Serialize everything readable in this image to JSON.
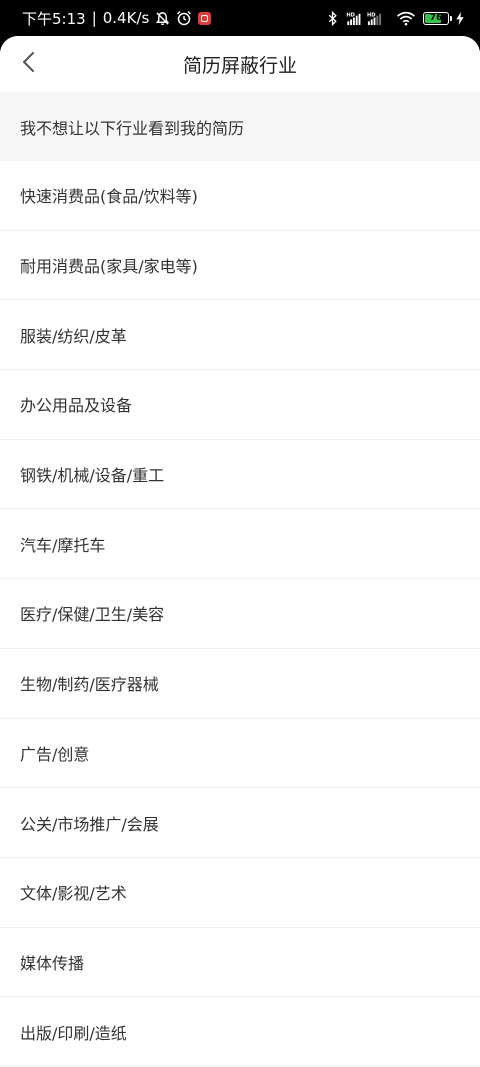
{
  "status_bar": {
    "time": "下午5:13",
    "separator": "|",
    "net_speed": "0.4K/s",
    "battery_level": "76",
    "battery_fill_fraction": 0.76,
    "icons": [
      "mute-icon",
      "alarm-icon",
      "app-notification-icon",
      "bluetooth-icon",
      "hd-signal-icon",
      "wifi-icon",
      "battery-icon",
      "charging-icon"
    ]
  },
  "header": {
    "title": "简历屏蔽行业",
    "back_icon": "chevron-left-icon"
  },
  "section_note": "我不想让以下行业看到我的简历",
  "industries": [
    "快速消费品(食品/饮料等)",
    "耐用消费品(家具/家电等)",
    "服装/纺织/皮革",
    "办公用品及设备",
    "钢铁/机械/设备/重工",
    "汽车/摩托车",
    "医疗/保健/卫生/美容",
    "生物/制药/医疗器械",
    "广告/创意",
    "公关/市场推广/会展",
    "文体/影视/艺术",
    "媒体传播",
    "出版/印刷/造纸"
  ],
  "colors": {
    "status_bg": "#000000",
    "panel_bg": "#ffffff",
    "section_bg": "#f6f6f6",
    "text": "#333333",
    "divider": "#f0f0f0",
    "battery_green": "#35c24a"
  }
}
